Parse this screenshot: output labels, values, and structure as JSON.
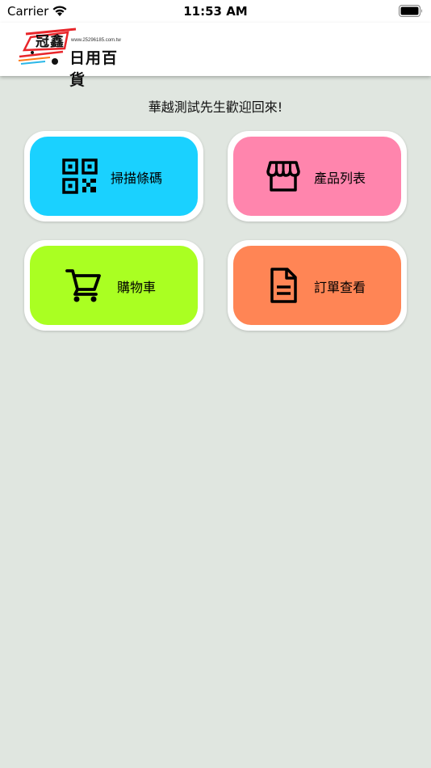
{
  "status_bar": {
    "carrier": "Carrier",
    "time": "11:53 AM"
  },
  "header": {
    "logo": {
      "name_top": "冠鑫",
      "url": "www.25296185.com.tw",
      "name_bottom": "日用百貨"
    }
  },
  "welcome": "華越測試先生歡迎回來!",
  "menu": [
    {
      "label": "掃描條碼",
      "icon": "qr-code-icon",
      "color": "#1ad1ff"
    },
    {
      "label": "產品列表",
      "icon": "storefront-icon",
      "color": "#ff85ad"
    },
    {
      "label": "購物車",
      "icon": "shopping-cart-icon",
      "color": "#aaff22"
    },
    {
      "label": "訂單查看",
      "icon": "document-icon",
      "color": "#ff8555"
    }
  ]
}
